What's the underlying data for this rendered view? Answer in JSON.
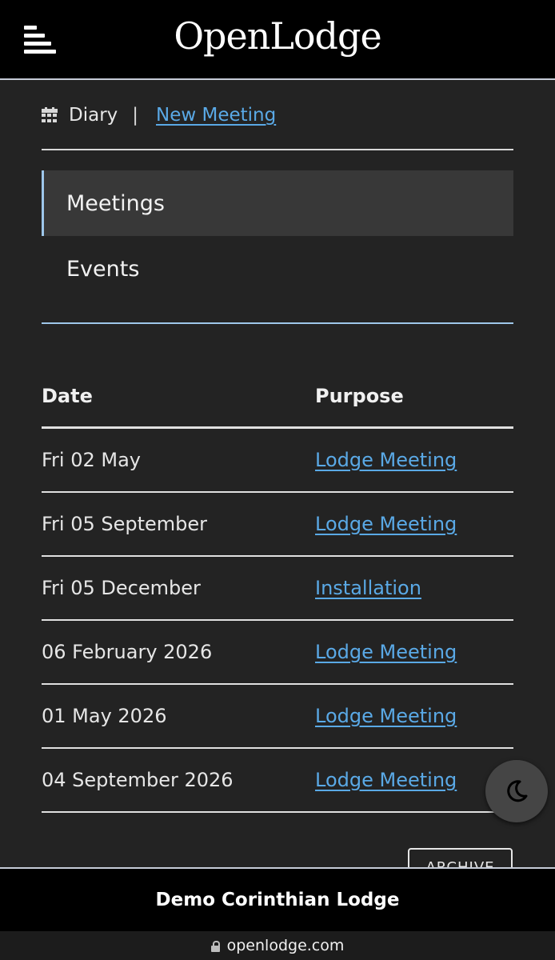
{
  "header": {
    "logo_text": "OpenLodge"
  },
  "breadcrumb": {
    "section": "Diary",
    "separator": "|",
    "link": "New Meeting"
  },
  "tabs": [
    {
      "label": "Meetings",
      "active": true
    },
    {
      "label": "Events",
      "active": false
    }
  ],
  "table": {
    "headers": [
      "Date",
      "Purpose"
    ],
    "rows": [
      {
        "date": "Fri 02 May",
        "purpose": "Lodge Meeting"
      },
      {
        "date": "Fri 05 September",
        "purpose": "Lodge Meeting"
      },
      {
        "date": "Fri 05 December",
        "purpose": "Installation"
      },
      {
        "date": "06 February 2026",
        "purpose": "Lodge Meeting"
      },
      {
        "date": "01 May 2026",
        "purpose": "Lodge Meeting"
      },
      {
        "date": "04 September 2026",
        "purpose": "Lodge Meeting"
      }
    ]
  },
  "archive_label": "ARCHIVE",
  "footer": {
    "lodge_name": "Demo Corinthian Lodge"
  },
  "browser": {
    "url": "openlodge.com"
  },
  "icons": {
    "menu": "hamburger-menu-icon",
    "calendar": "calendar-icon",
    "theme": "moon-icon",
    "lock": "lock-icon"
  },
  "colors": {
    "background": "#232323",
    "header": "#000000",
    "link": "#5aa9e6",
    "accent": "#9ec7ea",
    "active_tab": "#383838"
  }
}
